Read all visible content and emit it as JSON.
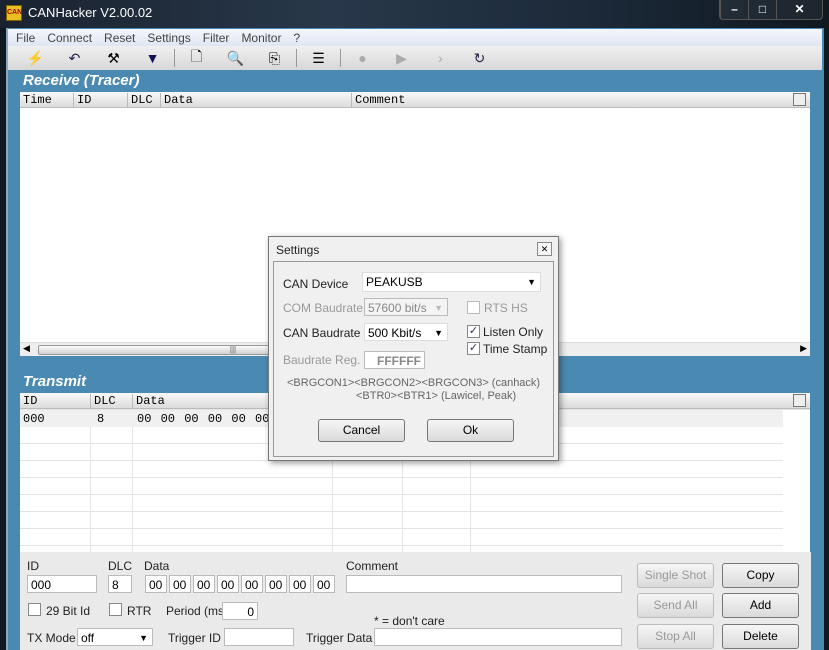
{
  "window": {
    "title": "CANHacker V2.00.02",
    "icon": "canhacker-logo-icon",
    "controls": [
      "minimize-icon",
      "maximize-icon",
      "close-icon"
    ]
  },
  "menu": [
    "File",
    "Connect",
    "Reset",
    "Settings",
    "Filter",
    "Monitor",
    "?"
  ],
  "toolbar": [
    "lightning-connect-icon",
    "undo-reset-icon",
    "tools-settings-icon",
    "filter-funnel-icon",
    "new-document-icon",
    "preview-search-icon",
    "copy-icon",
    "list-icon",
    "record-icon",
    "play-step-icon",
    "play-icon",
    "refresh-icon"
  ],
  "receive": {
    "title": "Receive (Tracer)",
    "columns": [
      "Time",
      "ID",
      "DLC",
      "Data",
      "Comment"
    ],
    "scroll_thumb": "|||"
  },
  "transmit": {
    "title": "Transmit",
    "columns": [
      "ID",
      "DLC",
      "Data"
    ],
    "rows": [
      {
        "id": "000",
        "dlc": "8",
        "data": "00 00 00 00 00 00"
      }
    ]
  },
  "form": {
    "id_label": "ID",
    "id": "000",
    "dlc_label": "DLC",
    "dlc": "8",
    "data_label": "Data",
    "data": [
      "00",
      "00",
      "00",
      "00",
      "00",
      "00",
      "00",
      "00"
    ],
    "comment_label": "Comment",
    "comment": "",
    "bit29": "29 Bit Id",
    "rtr": "RTR",
    "period_label": "Period (ms)",
    "period": "0",
    "dont_care": "* = don't care",
    "txmode_label": "TX Mode",
    "txmode": "off",
    "trigger_id_label": "Trigger ID",
    "trigger_id": "",
    "trigger_data_label": "Trigger Data",
    "trigger_data": "",
    "buttons": {
      "single_shot": "Single Shot",
      "copy": "Copy",
      "send_all": "Send All",
      "add": "Add",
      "stop_all": "Stop All",
      "delete": "Delete"
    }
  },
  "dialog": {
    "title": "Settings",
    "can_device_label": "CAN Device",
    "can_device": "PEAKUSB",
    "com_baud_label": "COM Baudrate",
    "com_baud": "57600 bit/s",
    "rts_hs": "RTS HS",
    "rts_checked": false,
    "can_baud_label": "CAN Baudrate",
    "can_baud": "500 Kbit/s",
    "listen_only": "Listen Only",
    "listen_checked": true,
    "time_stamp": "Time Stamp",
    "time_checked": true,
    "baud_reg_label": "Baudrate Reg.",
    "baud_reg": "FFFFFF",
    "hint1": "<BRGCON1><BRGCON2><BRGCON3> (canhack)",
    "hint2": "<BTR0><BTR1> (Lawicel, Peak)",
    "cancel": "Cancel",
    "ok": "Ok"
  }
}
